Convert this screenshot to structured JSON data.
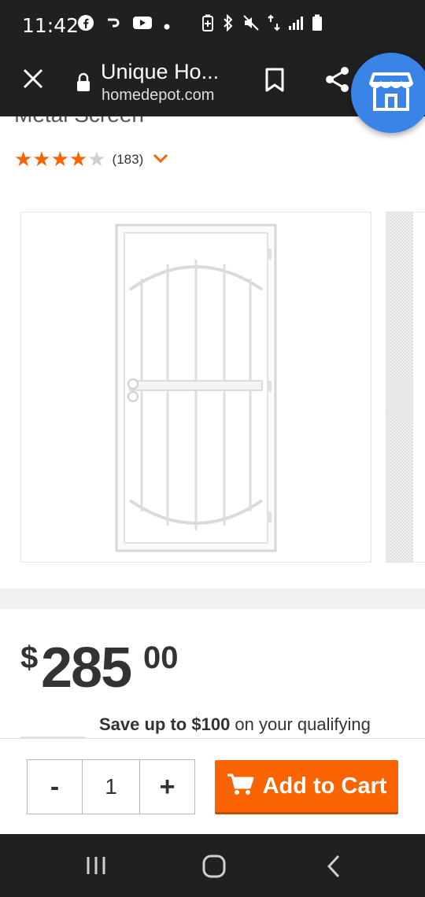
{
  "status_bar": {
    "time": "11:42",
    "left_icons": [
      "facebook-icon",
      "link-icon",
      "youtube-icon",
      "dot-icon"
    ],
    "right_icons": [
      "battery-saver-icon",
      "bluetooth-icon",
      "mute-icon",
      "data-4g-icon",
      "signal-icon",
      "battery-icon"
    ]
  },
  "browser": {
    "page_title": "Unique Ho...",
    "url": "homedepot.com"
  },
  "product": {
    "title_partial": "Metal Screen",
    "rating_stars": 4,
    "review_count": "(183)",
    "colors": {
      "accent": "#f96302",
      "store_fab": "#3a84e8"
    }
  },
  "price": {
    "dollar_sign": "$",
    "dollars": "285",
    "cents": "00"
  },
  "promo": {
    "bold": "Save up to $100",
    "rest": " on your qualifying"
  },
  "cart": {
    "minus": "-",
    "quantity": "1",
    "plus": "+",
    "add_label": "Add to Cart"
  }
}
